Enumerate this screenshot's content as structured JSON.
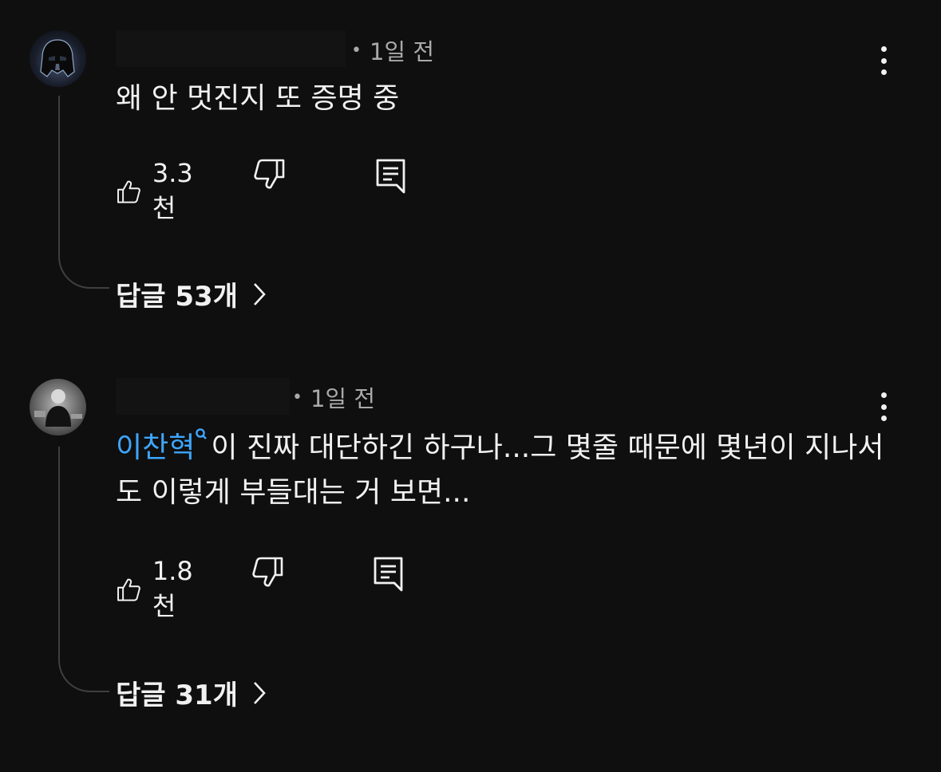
{
  "comments": [
    {
      "time": "1일 전",
      "text": "왜 안 멋진지 또 증명 중",
      "likes": "3.3천",
      "replies_label": "답글 53개",
      "avatar": "darth-vader-avatar"
    },
    {
      "time": "1일 전",
      "mention": "이찬혁",
      "text": "이 진짜 대단하긴 하구나...그 몇줄 때문에 몇년이 지나서도 이렇게 부들대는 거 보면...",
      "likes": "1.8천",
      "replies_label": "답글 31개",
      "avatar": "person-avatar"
    }
  ],
  "separator": "•",
  "colors": {
    "background": "#0f0f0f",
    "text": "#f1f1f1",
    "muted": "#aaaaaa",
    "mention": "#3ea6ff",
    "thread_line": "#3f3f3f"
  },
  "icons": [
    "thumbs-up-icon",
    "thumbs-down-icon",
    "reply-icon",
    "kebab-menu-icon",
    "chevron-right-icon",
    "search-icon"
  ]
}
